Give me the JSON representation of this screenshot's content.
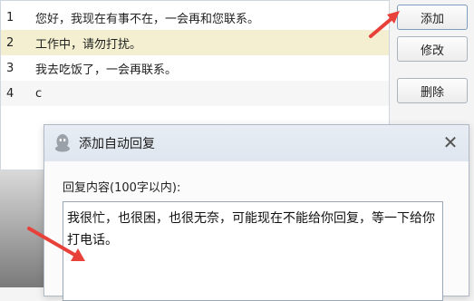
{
  "list": {
    "rows": [
      {
        "num": "1",
        "text": "您好，我现在有事不在，一会再和您联系。"
      },
      {
        "num": "2",
        "text": "工作中，请勿打扰。"
      },
      {
        "num": "3",
        "text": "我去吃饭了，一会再联系。"
      },
      {
        "num": "4",
        "text": "c"
      }
    ]
  },
  "buttons": {
    "add": "添加",
    "edit": "修改",
    "delete": "删除"
  },
  "dialog": {
    "title": "添加自动回复",
    "close_glyph": "✕",
    "label": "回复内容(100字以内):",
    "content": "我很忙，也很困，也很无奈，可能现在不能给你回复，等一下给你打电话。"
  },
  "colors": {
    "selected_row": "#f3efd0",
    "arrow": "#e8413a",
    "qq_icon": "#9aa1a8"
  }
}
